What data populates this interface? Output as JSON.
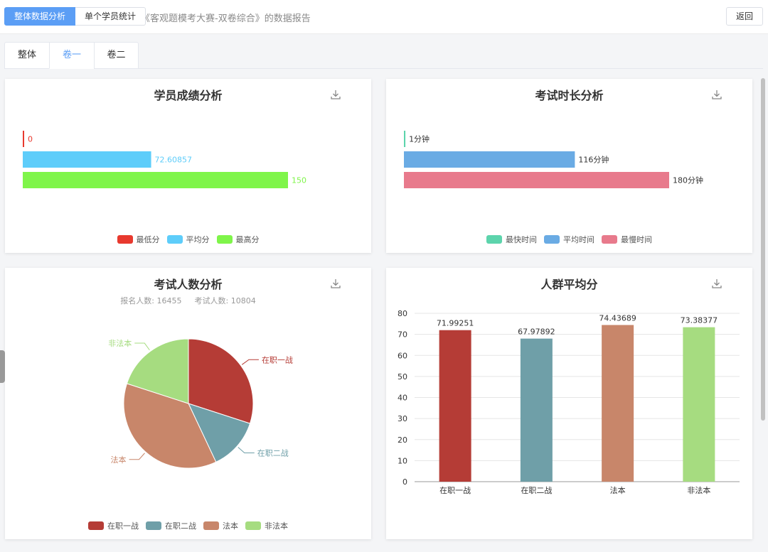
{
  "header": {
    "tab_overall": "整体数据分析",
    "tab_single": "单个学员统计",
    "report_title": "《客观题模考大赛-双卷综合》的数据报告",
    "back_label": "返回"
  },
  "paper_tabs": [
    {
      "label": "整体",
      "active": false
    },
    {
      "label": "卷一",
      "active": true
    },
    {
      "label": "卷二",
      "active": false
    }
  ],
  "score_card": {
    "title": "学员成绩分析",
    "legend": [
      {
        "label": "最低分",
        "color": "#e8392e"
      },
      {
        "label": "平均分",
        "color": "#5ecdfa"
      },
      {
        "label": "最高分",
        "color": "#7ff54a"
      }
    ]
  },
  "time_card": {
    "title": "考试时长分析",
    "legend": [
      {
        "label": "最快时间",
        "color": "#5dd4ac"
      },
      {
        "label": "平均时间",
        "color": "#6aabe4"
      },
      {
        "label": "最慢时间",
        "color": "#e87a8c"
      }
    ]
  },
  "count_card": {
    "title": "考试人数分析",
    "registered": "报名人数: 16455",
    "examined": "考试人数: 10804",
    "legend": [
      {
        "label": "在职一战",
        "color": "#b53c36"
      },
      {
        "label": "在职二战",
        "color": "#6f9fa8"
      },
      {
        "label": "法本",
        "color": "#c8866a"
      },
      {
        "label": "非法本",
        "color": "#a6dc80"
      }
    ]
  },
  "avg_card": {
    "title": "人群平均分"
  },
  "chart_data": [
    {
      "type": "bar",
      "orientation": "horizontal",
      "categories": [
        "最低分",
        "平均分",
        "最高分"
      ],
      "values": [
        0,
        72.60857,
        150
      ],
      "value_labels": [
        "0",
        "72.60857",
        "150"
      ],
      "colors": [
        "#e8392e",
        "#5ecdfa",
        "#7ff54a"
      ],
      "xlim": [
        0,
        150
      ],
      "legend_position": "bottom"
    },
    {
      "type": "bar",
      "orientation": "horizontal",
      "categories": [
        "最快时间",
        "平均时间",
        "最慢时间"
      ],
      "values": [
        1,
        116,
        180
      ],
      "value_labels": [
        "1分钟",
        "116分钟",
        "180分钟"
      ],
      "colors": [
        "#5dd4ac",
        "#6aabe4",
        "#e87a8c"
      ],
      "xlim": [
        0,
        180
      ],
      "legend_position": "bottom"
    },
    {
      "type": "pie",
      "categories": [
        "在职一战",
        "在职二战",
        "法本",
        "非法本"
      ],
      "values": [
        30,
        13,
        37,
        20
      ],
      "colors": [
        "#b53c36",
        "#6f9fa8",
        "#c8866a",
        "#a6dc80"
      ],
      "legend_position": "bottom"
    },
    {
      "type": "bar",
      "categories": [
        "在职一战",
        "在职二战",
        "法本",
        "非法本"
      ],
      "values": [
        71.99251,
        67.97892,
        74.43689,
        73.38377
      ],
      "value_labels": [
        "71.99251",
        "67.97892",
        "74.43689",
        "73.38377"
      ],
      "colors": [
        "#b53c36",
        "#6f9fa8",
        "#c8866a",
        "#a6dc80"
      ],
      "ylim": [
        0,
        80
      ],
      "yticks": [
        0,
        10,
        20,
        30,
        40,
        50,
        60,
        70,
        80
      ],
      "grid": true
    }
  ]
}
